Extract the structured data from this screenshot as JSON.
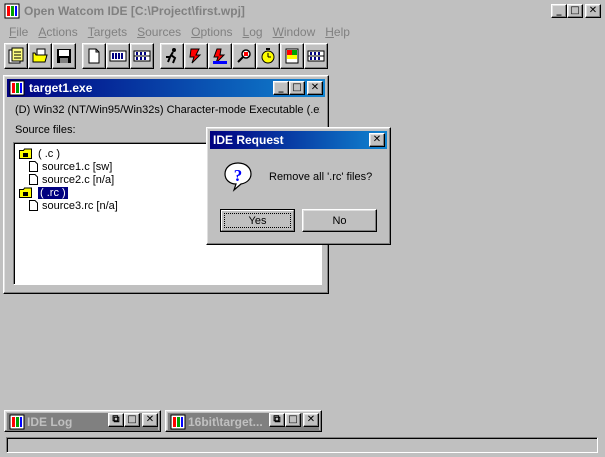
{
  "window": {
    "title": "Open Watcom IDE [C:\\Project\\first.wpj]",
    "minimize_glyph": "_",
    "maximize_glyph": "□",
    "close_glyph": "✕",
    "app_icon": "watcom-app-icon"
  },
  "menu": {
    "items": [
      {
        "label": "File",
        "key": "F"
      },
      {
        "label": "Actions",
        "key": "A"
      },
      {
        "label": "Targets",
        "key": "T"
      },
      {
        "label": "Sources",
        "key": "S"
      },
      {
        "label": "Options",
        "key": "O"
      },
      {
        "label": "Log",
        "key": "L"
      },
      {
        "label": "Window",
        "key": "W"
      },
      {
        "label": "Help",
        "key": "H"
      }
    ]
  },
  "toolbar": {
    "buttons": [
      {
        "icon": "new-project-icon"
      },
      {
        "icon": "open-project-icon"
      },
      {
        "icon": "save-icon"
      },
      {
        "icon": "new-source-icon"
      },
      {
        "icon": "make-target-icon"
      },
      {
        "icon": "make-all-icon"
      },
      {
        "icon": "run-icon"
      },
      {
        "icon": "debug-icon"
      },
      {
        "icon": "sample-icon"
      },
      {
        "icon": "browse-icon"
      },
      {
        "icon": "profile-icon"
      },
      {
        "icon": "editor-icon"
      },
      {
        "icon": "remake-icon"
      }
    ]
  },
  "target_window": {
    "title": "target1.exe",
    "description": "(D) Win32 (NT/Win95/Win32s) Character-mode Executable (.ex",
    "source_files_label": "Source files:",
    "tree": [
      {
        "type": "folder",
        "label": "( .c )",
        "selected": false
      },
      {
        "type": "file",
        "label": "source1.c [sw]",
        "selected": false
      },
      {
        "type": "file",
        "label": "source2.c [n/a]",
        "selected": false
      },
      {
        "type": "folder",
        "label": "( .rc )",
        "selected": true
      },
      {
        "type": "file",
        "label": "source3.rc [n/a]",
        "selected": false
      }
    ]
  },
  "dialog": {
    "title": "IDE Request",
    "message": "Remove all '.rc' files?",
    "yes_label": "Yes",
    "no_label": "No",
    "icon": "question-icon"
  },
  "minimized": [
    {
      "title": "IDE Log"
    },
    {
      "title": "16bit\\target..."
    }
  ],
  "statusbar": {
    "text": ""
  },
  "colors": {
    "face": "#c0c0c0",
    "active_title": "#000080",
    "inactive_title": "#808080",
    "selection": "#000080"
  }
}
